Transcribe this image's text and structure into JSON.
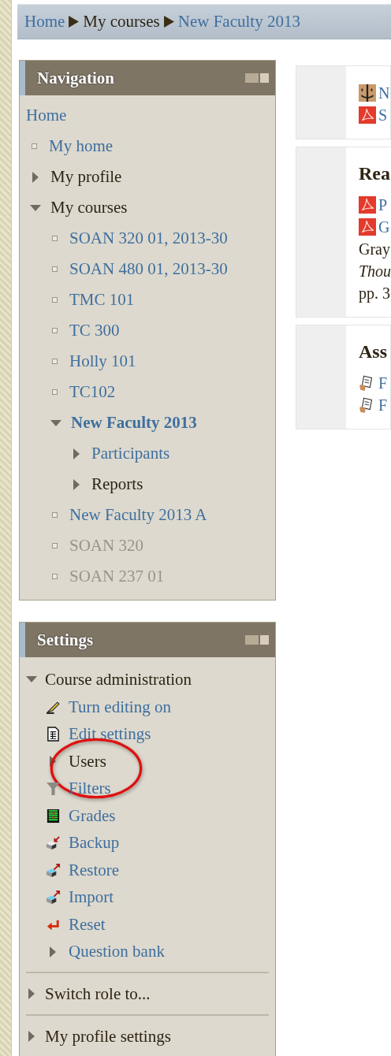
{
  "breadcrumb": [
    {
      "label": "Home",
      "link": true
    },
    {
      "label": "My courses",
      "link": false
    },
    {
      "label": "New Faculty 2013",
      "link": true
    }
  ],
  "navigation": {
    "title": "Navigation",
    "items": [
      {
        "kind": "plain",
        "label": "Home",
        "current": false,
        "disabled": false
      },
      {
        "kind": "leaf",
        "label": "My home",
        "current": false,
        "disabled": false
      },
      {
        "kind": "branch",
        "label": "My profile",
        "link": false,
        "expanded": false,
        "current": false
      },
      {
        "kind": "branch",
        "label": "My courses",
        "link": false,
        "expanded": true,
        "current": false,
        "children": [
          {
            "kind": "leaf",
            "label": "SOAN 320 01, 2013-30",
            "current": false,
            "disabled": false
          },
          {
            "kind": "leaf",
            "label": "SOAN 480 01, 2013-30",
            "current": false,
            "disabled": false
          },
          {
            "kind": "leaf",
            "label": "TMC 101",
            "current": false,
            "disabled": false
          },
          {
            "kind": "leaf",
            "label": "TC 300",
            "current": false,
            "disabled": false
          },
          {
            "kind": "leaf",
            "label": "Holly 101",
            "current": false,
            "disabled": false
          },
          {
            "kind": "leaf",
            "label": "TC102",
            "current": false,
            "disabled": false
          },
          {
            "kind": "branch",
            "label": "New Faculty 2013",
            "link": true,
            "expanded": true,
            "current": true,
            "children": [
              {
                "kind": "branch",
                "label": "Participants",
                "link": true,
                "expanded": false,
                "current": false
              },
              {
                "kind": "branch",
                "label": "Reports",
                "link": false,
                "expanded": false,
                "current": false
              }
            ]
          },
          {
            "kind": "leaf",
            "label": "New Faculty 2013 A",
            "current": false,
            "disabled": false
          },
          {
            "kind": "leaf",
            "label": "SOAN 320",
            "current": false,
            "disabled": true
          },
          {
            "kind": "leaf",
            "label": "SOAN 237 01",
            "current": false,
            "disabled": true
          }
        ]
      }
    ]
  },
  "settings": {
    "title": "Settings",
    "sections": [
      {
        "kind": "branch",
        "label": "Course administration",
        "link": false,
        "expanded": true,
        "children": [
          {
            "kind": "edit",
            "label": "Turn editing on"
          },
          {
            "kind": "document",
            "label": "Edit settings"
          },
          {
            "kind": "branch",
            "label": "Users",
            "link": false,
            "expanded": false,
            "circled": true
          },
          {
            "kind": "filter",
            "label": "Filters"
          },
          {
            "kind": "grades",
            "label": "Grades"
          },
          {
            "kind": "backup",
            "label": "Backup"
          },
          {
            "kind": "restore",
            "label": "Restore"
          },
          {
            "kind": "restore",
            "label": "Import"
          },
          {
            "kind": "reset",
            "label": "Reset"
          },
          {
            "kind": "branch",
            "label": "Question bank",
            "link": true,
            "expanded": false,
            "circled": false
          }
        ]
      },
      {
        "kind": "branch",
        "label": "Switch role to...",
        "link": false,
        "expanded": false
      },
      {
        "kind": "branch",
        "label": "My profile settings",
        "link": false,
        "expanded": false
      }
    ]
  },
  "content": [
    {
      "lines": [
        {
          "kind": "folder",
          "text": "N"
        },
        {
          "kind": "pdf",
          "text": "S"
        }
      ]
    },
    {
      "heading": "Rea",
      "lines": [
        {
          "kind": "pdf",
          "text": "P"
        },
        {
          "kind": "pdf",
          "text": "G"
        },
        {
          "kind": "text",
          "text": "Gray"
        },
        {
          "kind": "italic",
          "text": "Thou"
        },
        {
          "kind": "text",
          "text": "pp. 3"
        }
      ]
    },
    {
      "heading": "Ass",
      "lines": [
        {
          "kind": "assignment",
          "text": "F"
        },
        {
          "kind": "assignment",
          "text": "F"
        }
      ]
    }
  ]
}
